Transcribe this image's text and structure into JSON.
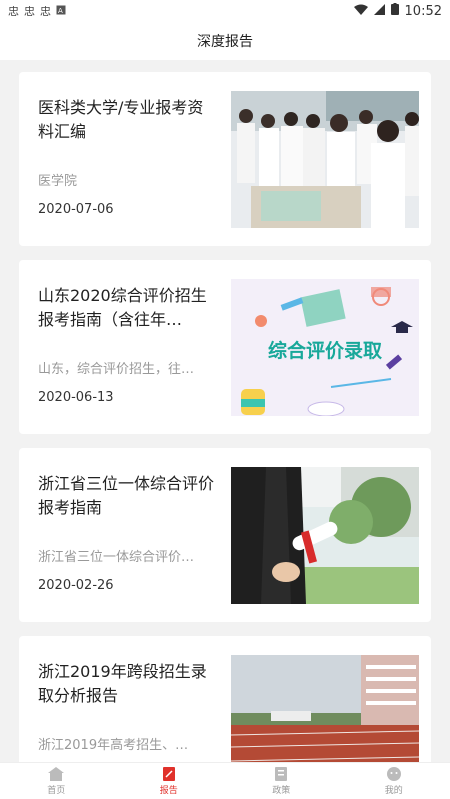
{
  "status": {
    "time": "10:52",
    "left_icons": [
      "pinyin-icon",
      "pinyin-icon",
      "pinyin-icon",
      "a-icon"
    ]
  },
  "header": {
    "title": "深度报告"
  },
  "reports": [
    {
      "title": "医科类大学/专业报考资料汇编",
      "subtitle": "医学院",
      "date": "2020-07-06",
      "image": "doctors-photo"
    },
    {
      "title": "山东2020综合评价招生报考指南（含往年…",
      "subtitle": "山东，综合评价招生，往…",
      "date": "2020-06-13",
      "image": "evaluation-illustration",
      "image_text": "综合评价录取"
    },
    {
      "title": "浙江省三位一体综合评价报考指南",
      "subtitle": "浙江省三位一体综合评价…",
      "date": "2020-02-26",
      "image": "graduation-photo"
    },
    {
      "title": "浙江2019年跨段招生录取分析报告",
      "subtitle": "浙江2019年高考招生、…",
      "date": "",
      "image": "campus-track-photo"
    }
  ],
  "nav": [
    {
      "label": "首页",
      "icon": "home-icon"
    },
    {
      "label": "报告",
      "icon": "report-icon",
      "active": true
    },
    {
      "label": "政策",
      "icon": "policy-icon"
    },
    {
      "label": "我的",
      "icon": "profile-icon"
    }
  ],
  "colors": {
    "accent": "#e0312b",
    "background": "#f2f2f2"
  }
}
